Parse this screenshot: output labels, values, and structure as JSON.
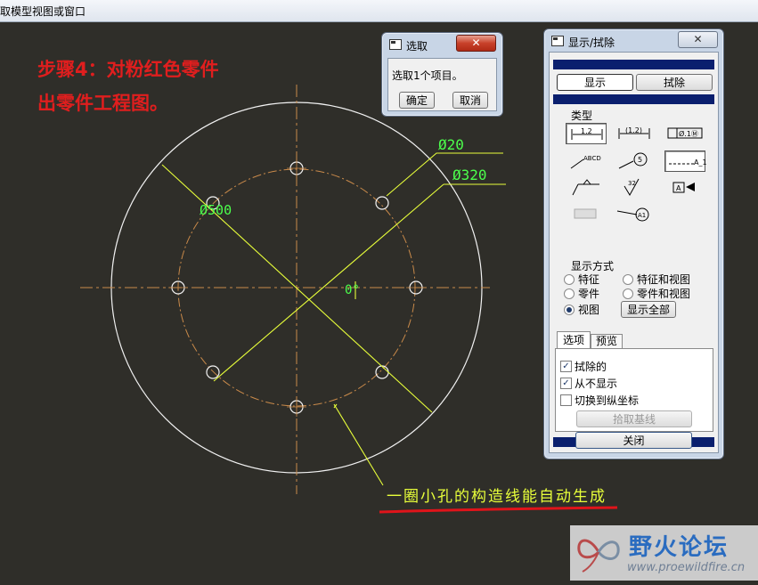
{
  "top_menu": "取模型视图或窗口",
  "steps": [
    "步骤4：对粉红色零件",
    "出零件工程图。"
  ],
  "caption": "一圈小孔的构造线能自动生成",
  "dims": {
    "d20": "Ø20",
    "d320": "Ø320",
    "d500": "Ø500",
    "angle": "0°"
  },
  "select_dialog": {
    "title": "选取",
    "message": "选取1个项目。",
    "ok": "确定",
    "cancel": "取消",
    "close": "✕"
  },
  "show_dialog": {
    "title": "显示/拭除",
    "close_x": "✕",
    "show_btn": "显示",
    "erase_btn": "拭除",
    "type_label": "类型",
    "display_mode_label": "显示方式",
    "modes": [
      "特征",
      "特征和视图",
      "零件",
      "零件和视图",
      "视图"
    ],
    "selected_mode": "视图",
    "show_all": "显示全部",
    "tabs": [
      "选项",
      "预览"
    ],
    "options": [
      {
        "label": "拭除的",
        "checked": true
      },
      {
        "label": "从不显示",
        "checked": true
      },
      {
        "label": "切换到纵坐标",
        "checked": false
      }
    ],
    "pick_baseline": "拾取基线",
    "close_btn": "关闭"
  },
  "watermark": {
    "name": "野火论坛",
    "url": "www.proewildfire.cn"
  },
  "colors": {
    "background": "#2f2e29",
    "step_red": "#e01e1e",
    "dim_green": "#4cff4c",
    "leader_yellow": "#e8ff3a",
    "center_orange": "#c98a4a",
    "navy": "#0a1f6e"
  }
}
